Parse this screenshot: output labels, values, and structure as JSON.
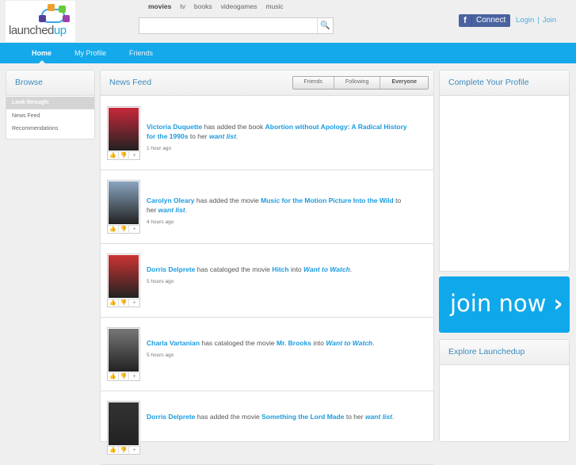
{
  "logo": {
    "text_a": "launched",
    "text_b": "up"
  },
  "categories": [
    {
      "label": "movies",
      "active": true
    },
    {
      "label": "tv"
    },
    {
      "label": "books"
    },
    {
      "label": "videogames"
    },
    {
      "label": "music"
    }
  ],
  "search": {
    "placeholder": "",
    "value": ""
  },
  "header": {
    "connect": "Connect",
    "fb": "f",
    "login": "Login",
    "sep": "|",
    "join": "Join"
  },
  "nav": [
    "Home",
    "My Profile",
    "Friends"
  ],
  "browse": {
    "title": "Browse",
    "look": "Look through:",
    "items": [
      "News Feed",
      "Recommendations"
    ]
  },
  "feed": {
    "title": "News Feed",
    "tabs": [
      "Friends",
      "Following",
      "Everyone"
    ],
    "items": [
      {
        "user": "Victoria Duquette",
        "action": "has added the book",
        "title": "Abortion without Apology: A Radical History for the 1990s",
        "prep": "to her",
        "list": "want list",
        "time": "1 hour ago",
        "cover": "#c8283a"
      },
      {
        "user": "Carolyn Oleary",
        "action": "has added the movie",
        "title": "Music for the Motion Picture Into the Wild",
        "prep": "to her",
        "list": "want list",
        "time": "4 hours ago",
        "cover": "#8aa5c0"
      },
      {
        "user": "Dorris Delprete",
        "action": "has cataloged the movie",
        "title": "Hitch",
        "prep": "into",
        "list": "Want to Watch",
        "time": "5 hours ago",
        "cover": "#c33"
      },
      {
        "user": "Charla Vartanian",
        "action": "has cataloged the movie",
        "title": "Mr. Brooks",
        "prep": "into",
        "list": "Want to Watch",
        "time": "5 hours ago",
        "cover": "#777"
      },
      {
        "user": "Dorris Delprete",
        "action": "has added the movie",
        "title": "Something the Lord Made",
        "prep": "to her",
        "list": "want list",
        "time": "",
        "cover": "#333"
      }
    ]
  },
  "right": {
    "complete": "Complete Your Profile",
    "join_now": "join now",
    "chevron": "›",
    "explore": "Explore Launchedup"
  }
}
